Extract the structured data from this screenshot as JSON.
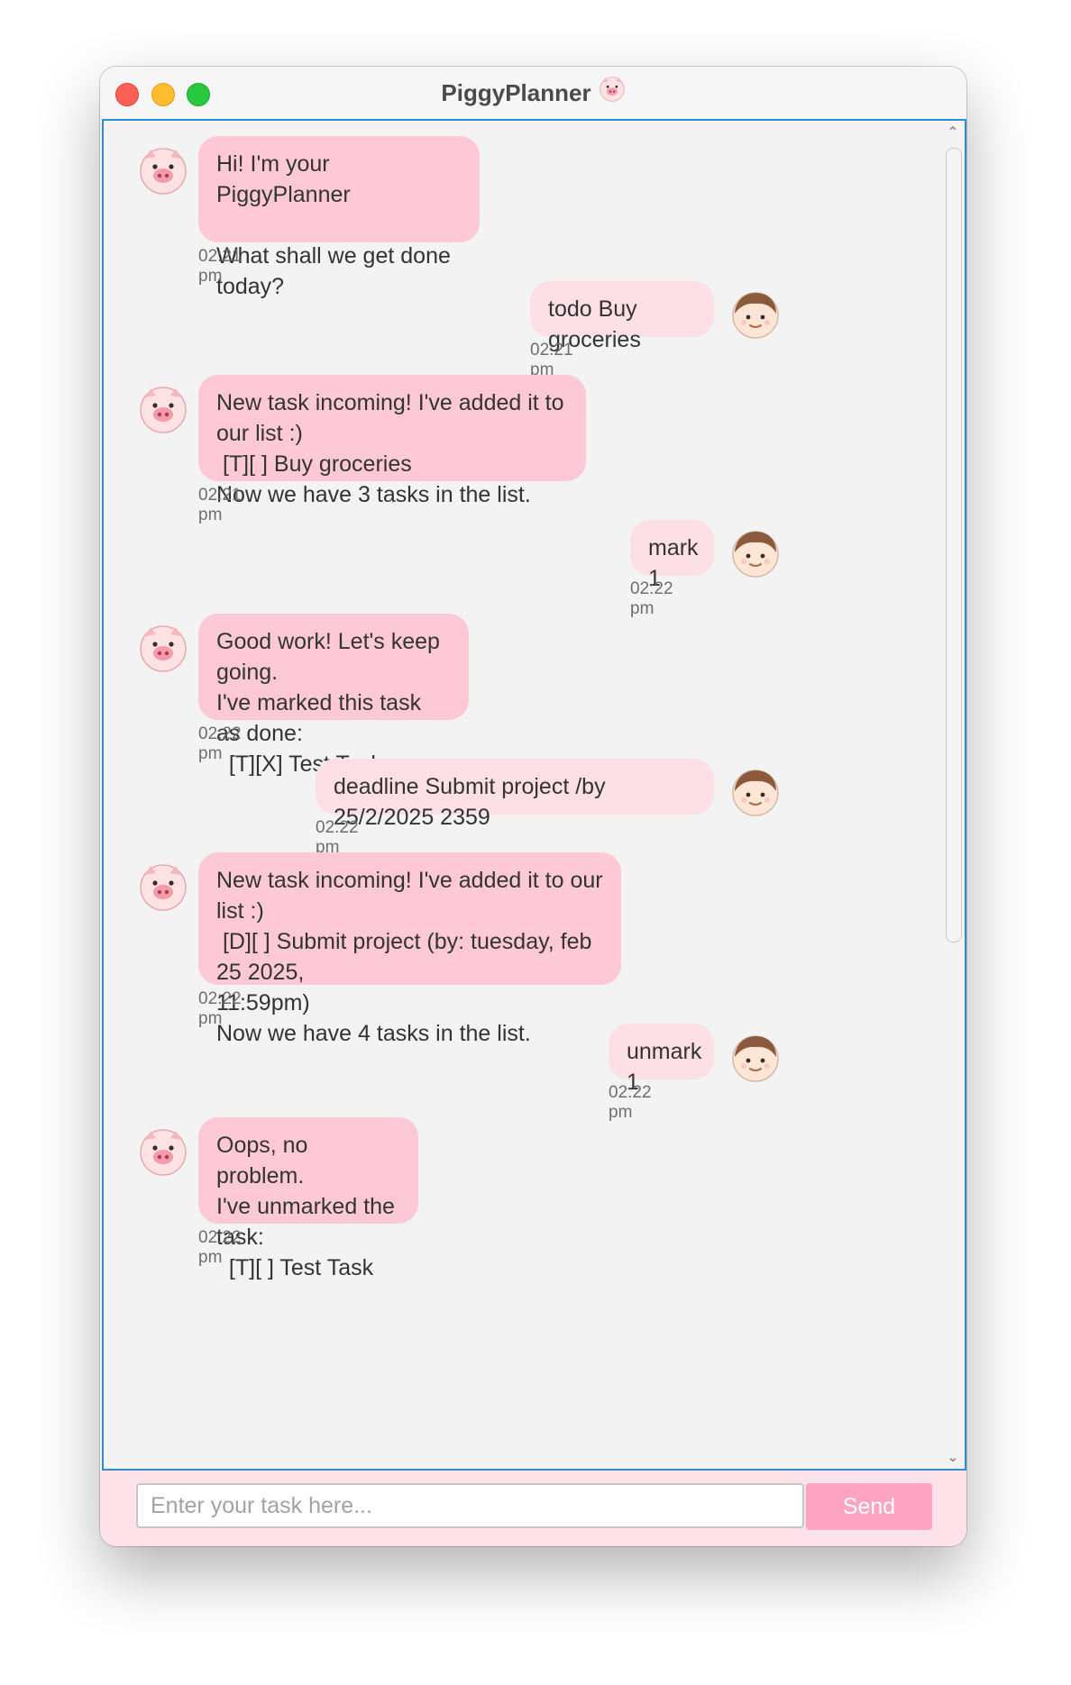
{
  "window": {
    "title": "PiggyPlanner"
  },
  "messages": [
    {
      "sender": "bot",
      "text": "Hi! I'm your PiggyPlanner\n\nWhat shall we get done today?",
      "time": "02:21 pm"
    },
    {
      "sender": "user",
      "text": "todo Buy groceries",
      "time": "02:21 pm"
    },
    {
      "sender": "bot",
      "text": "New task incoming! I've added it to our list :)\n [T][ ] Buy groceries\nNow we have 3 tasks in the list.",
      "time": "02:21 pm"
    },
    {
      "sender": "user",
      "text": "mark 1",
      "time": "02:22 pm"
    },
    {
      "sender": "bot",
      "text": "Good work! Let's keep going.\nI've marked this task as done:\n  [T][X] Test Task",
      "time": "02:22 pm"
    },
    {
      "sender": "user",
      "text": "deadline Submit project /by 25/2/2025 2359",
      "time": "02:22 pm"
    },
    {
      "sender": "bot",
      "text": "New task incoming! I've added it to our list :)\n [D][ ] Submit project (by: tuesday, feb 25 2025,\n11:59pm)\nNow we have 4 tasks in the list.",
      "time": "02:22 pm"
    },
    {
      "sender": "user",
      "text": "unmark 1",
      "time": "02:22 pm"
    },
    {
      "sender": "bot",
      "text": "Oops, no problem.\nI've unmarked the task:\n  [T][ ] Test Task",
      "time": "02:22 pm"
    }
  ],
  "input": {
    "placeholder": "Enter your task here...",
    "value": ""
  },
  "send_button": {
    "label": "Send"
  },
  "colors": {
    "bot_bubble": "#fec9d6",
    "user_bubble": "#fde0e6",
    "send_button": "#fea3c2",
    "input_bar": "#fde2ea",
    "focus_border": "#2e8fd0"
  },
  "icons": {
    "bot_avatar": "pig-face-icon",
    "user_avatar": "boy-face-icon",
    "title_icon": "pig-face-icon"
  }
}
